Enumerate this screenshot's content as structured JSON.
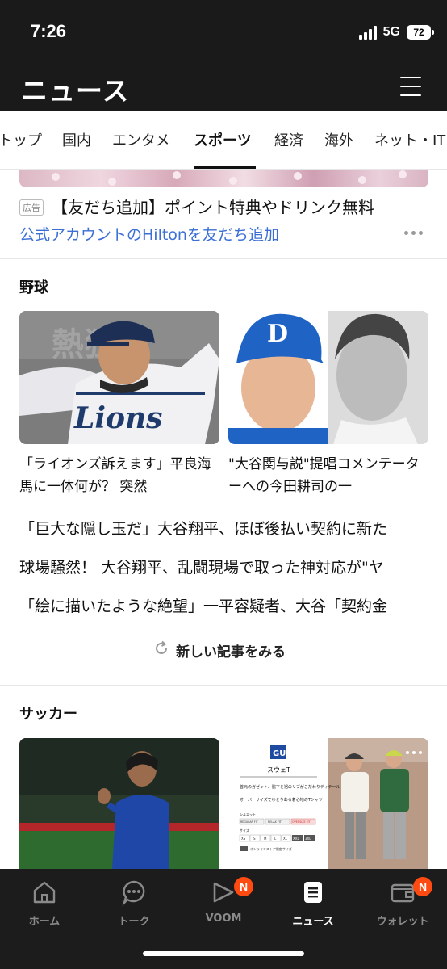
{
  "status_bar": {
    "time": "7:26",
    "network": "5G",
    "battery": "72"
  },
  "header": {
    "title": "ニュース"
  },
  "tabs": [
    {
      "label": "トップ"
    },
    {
      "label": "国内"
    },
    {
      "label": "エンタメ"
    },
    {
      "label": "スポーツ"
    },
    {
      "label": "経済"
    },
    {
      "label": "海外"
    },
    {
      "label": "ネット・IT"
    }
  ],
  "active_tab": "スポーツ",
  "ad": {
    "label": "広告",
    "title": "【友だち追加】ポイント特典やドリンク無料",
    "subtitle": "公式アカウントのHiltonを友だち追加"
  },
  "sections": {
    "baseball": {
      "title": "野球",
      "cards": [
        {
          "text": "「ライオンズ訴えます」平良海馬に一体何が？ 突然"
        },
        {
          "text": "\"大谷関与説\"提唱コメンテーターへの今田耕司の一"
        }
      ],
      "headlines": [
        "「巨大な隠し玉だ」大谷翔平、ほぼ後払い契約に新た",
        "球場騒然！ 大谷翔平、乱闘現場で取った神対応が\"ヤ",
        "「絵に描いたような絶望」一平容疑者、大谷「契約金"
      ],
      "more_label": "新しい記事をみる"
    },
    "soccer": {
      "title": "サッカー",
      "ad_image_text": {
        "brand": "GU",
        "product": "スウェT",
        "bullet1": "首元のガゼット、脇下と裾のリブがこだわりディテール",
        "bullet2": "オーバーサイズでゆとりある着心地のTシャツ",
        "silhouette_label": "シルエット",
        "fits": [
          "REGULAR FIT",
          "RELAX FIT",
          "OVERSIZE FIT"
        ],
        "size_label": "サイズ",
        "sizes": [
          "XS",
          "S",
          "M",
          "L",
          "XL",
          "XXL",
          "3XL"
        ],
        "online_note": "オンラインストア限定サイズ"
      }
    }
  },
  "bottom_nav": [
    {
      "label": "ホーム",
      "icon": "home-icon"
    },
    {
      "label": "トーク",
      "icon": "chat-bubble-icon"
    },
    {
      "label": "VOOM",
      "icon": "voom-play-icon",
      "badge": "N"
    },
    {
      "label": "ニュース",
      "icon": "news-icon"
    },
    {
      "label": "ウォレット",
      "icon": "wallet-icon",
      "badge": "N"
    }
  ],
  "active_nav": "ニュース"
}
